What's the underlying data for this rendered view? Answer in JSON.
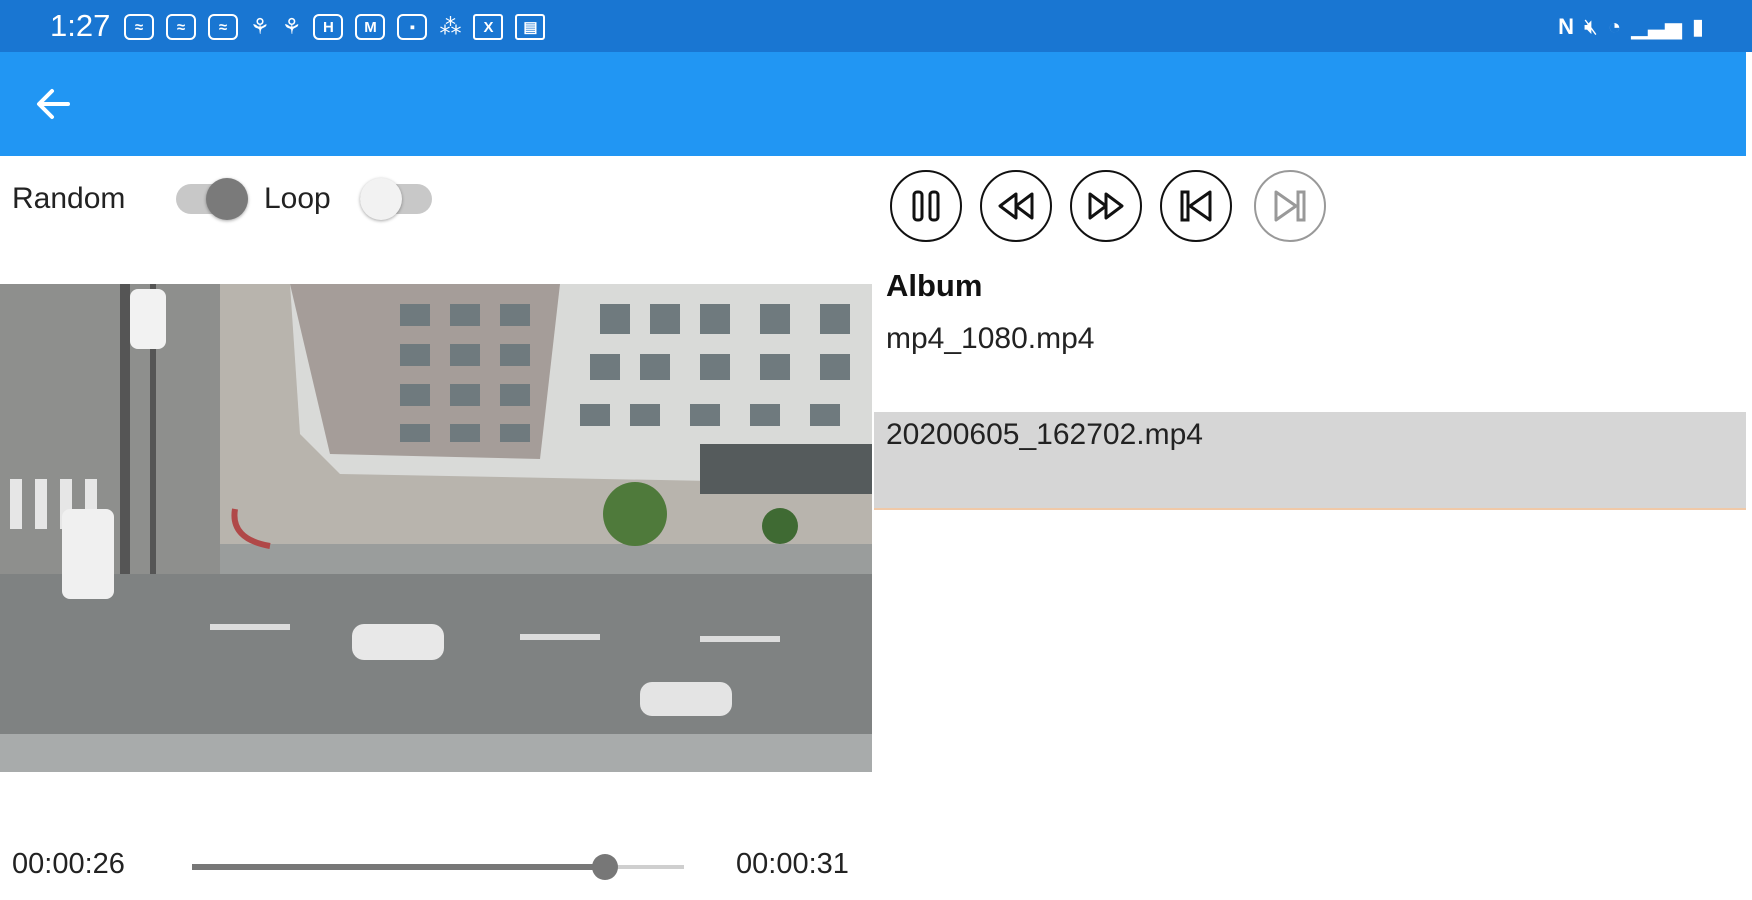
{
  "status_bar": {
    "time": "1:27",
    "notification_icons": [
      "notification-icon",
      "notification-icon",
      "notification-icon",
      "notification-icon",
      "notification-icon",
      "notification-icon",
      "notification-icon",
      "notification-icon",
      "notification-icon",
      "notification-icon",
      "notification-icon"
    ],
    "system_icons": [
      "nfc-icon",
      "mute-icon",
      "wifi-icon",
      "signal-icon",
      "battery-icon"
    ],
    "color": "#1976d2"
  },
  "app_bar": {
    "back_icon": "arrow-left-icon",
    "color": "#2196f3"
  },
  "toggles": {
    "random_label": "Random",
    "random_on": true,
    "loop_label": "Loop",
    "loop_on": false
  },
  "player": {
    "current_time": "00:00:26",
    "total_time": "00:00:31",
    "progress": 0.839
  },
  "transport": [
    {
      "icon": "pause-icon",
      "enabled": true
    },
    {
      "icon": "rewind-icon",
      "enabled": true
    },
    {
      "icon": "fast-forward-icon",
      "enabled": true
    },
    {
      "icon": "skip-previous-icon",
      "enabled": true
    },
    {
      "icon": "skip-next-icon",
      "enabled": false
    }
  ],
  "playlist": {
    "title": "Album",
    "items": [
      {
        "name": "mp4_1080.mp4",
        "selected": false
      },
      {
        "name": "20200605_162702.mp4",
        "selected": true
      }
    ]
  }
}
